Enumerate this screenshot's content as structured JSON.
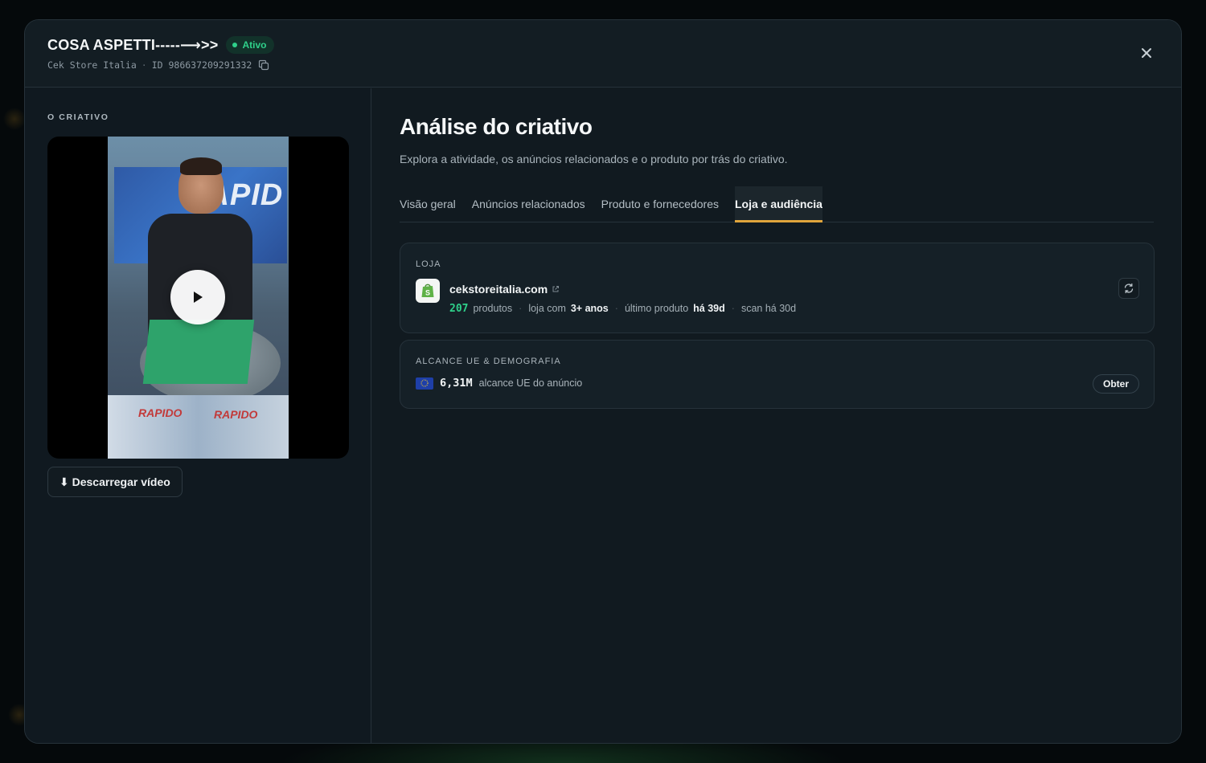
{
  "header": {
    "title": "COSA ASPETTI-----⟶>>",
    "status": "Ativo",
    "store_name": "Cek Store Italia",
    "separator": "·",
    "id_text": "ID 986637209291332"
  },
  "left": {
    "section_label": "O CRIATIVO",
    "video_banner_text": "RAPID",
    "box_label": "RAPIDO",
    "download_label": "⬇ Descarregar vídeo"
  },
  "main": {
    "title": "Análise do criativo",
    "description": "Explora a atividade, os anúncios relacionados e o produto por trás do criativo.",
    "tabs": [
      {
        "label": "Visão geral",
        "active": false
      },
      {
        "label": "Anúncios relacionados",
        "active": false
      },
      {
        "label": "Produto e fornecedores",
        "active": false
      },
      {
        "label": "Loja e audiência",
        "active": true
      }
    ],
    "store_card": {
      "label": "LOJA",
      "domain": "cekstoreitalia.com",
      "product_count": "207",
      "product_label": "produtos",
      "age_prefix": "loja com",
      "age_value": "3+ anos",
      "last_product_prefix": "último produto",
      "last_product_value": "há 39d",
      "scan_text": "scan há 30d"
    },
    "reach_card": {
      "label": "ALCANCE UE & DEMOGRAFIA",
      "value": "6,31M",
      "value_label": "alcance UE do anúncio",
      "button_label": "Obter"
    }
  },
  "colors": {
    "accent_green": "#2fd08a",
    "tab_underline": "#e0a53c",
    "panel_bg": "#111a20"
  }
}
